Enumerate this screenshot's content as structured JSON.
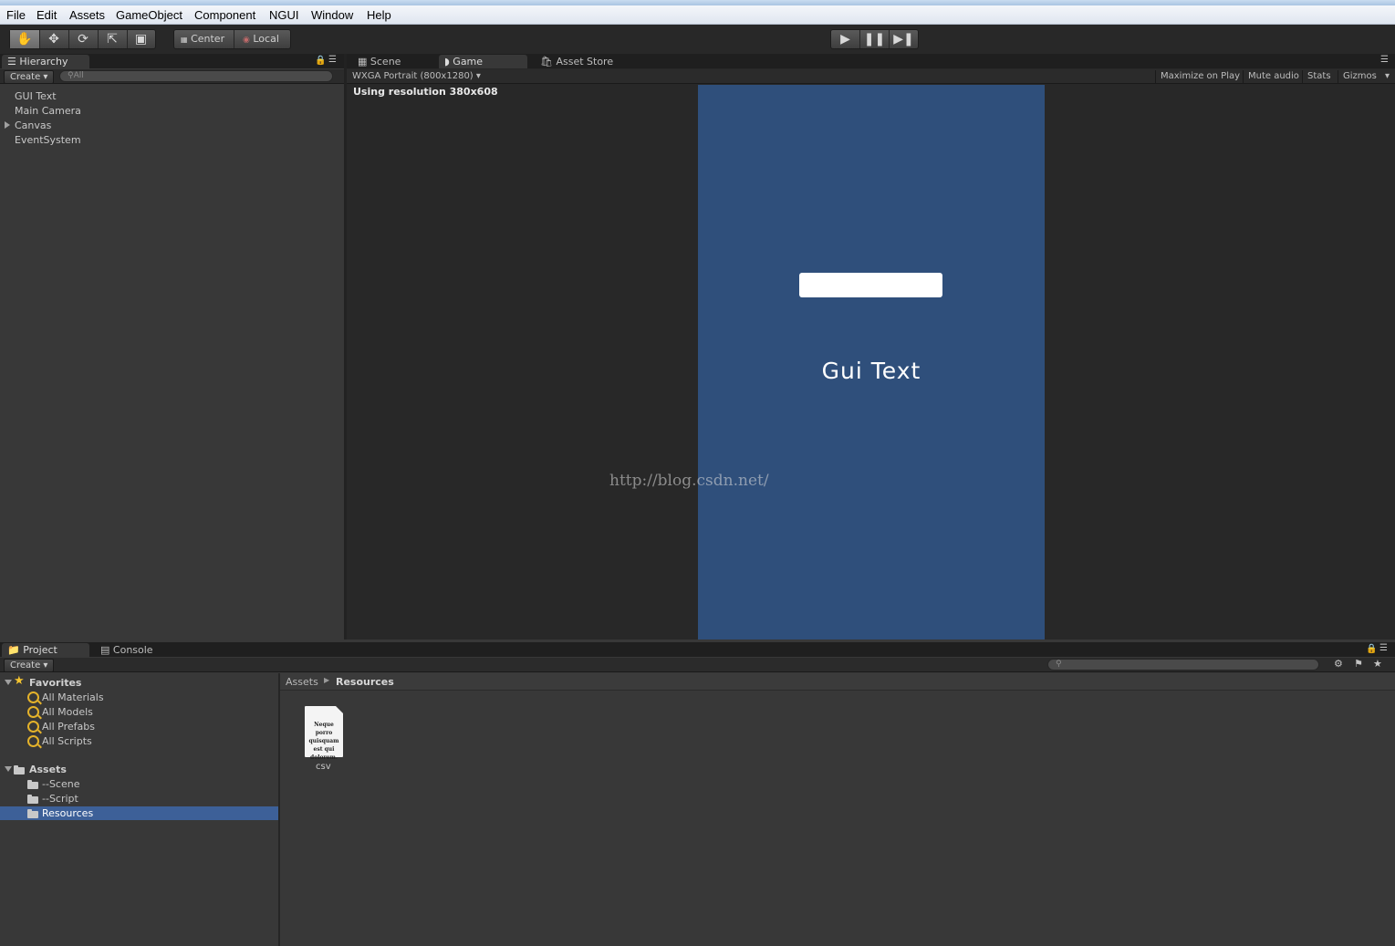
{
  "menubar": {
    "items": [
      "File",
      "Edit",
      "Assets",
      "GameObject",
      "Component",
      "NGUI",
      "Window",
      "Help"
    ]
  },
  "toolbar": {
    "tools": [
      "hand-icon",
      "move-icon",
      "rotate-icon",
      "scale-icon",
      "rect-icon"
    ],
    "pivot_center": "Center",
    "pivot_local": "Local",
    "play_icons": [
      "play-icon",
      "pause-icon",
      "step-icon"
    ]
  },
  "hierarchy": {
    "tab": "Hierarchy",
    "create": "Create",
    "search_placeholder": "All",
    "items": [
      "GUI Text",
      "Main Camera",
      "Canvas",
      "EventSystem"
    ]
  },
  "center_tabs": {
    "scene": "Scene",
    "game": "Game",
    "asset_store": "Asset Store"
  },
  "game": {
    "resolution_dropdown": "WXGA Portrait (800x1280)",
    "toggles": [
      "Maximize on Play",
      "Mute audio",
      "Stats",
      "Gizmos"
    ],
    "resolution_text": "Using resolution 380x608",
    "gui_text": "Gui Text",
    "watermark": "http://blog.csdn.net/"
  },
  "project": {
    "tab": "Project",
    "console_tab": "Console",
    "create": "Create",
    "favorites_header": "Favorites",
    "favorites": [
      "All Materials",
      "All Models",
      "All Prefabs",
      "All Scripts"
    ],
    "assets_header": "Assets",
    "folders": [
      "--Scene",
      "--Script",
      "Resources"
    ],
    "breadcrumb_root": "Assets",
    "breadcrumb_current": "Resources",
    "file_name": "csv",
    "file_thumb_text": "Neque porro quisquam est qui dolorem."
  },
  "colors": {
    "camera_bg": "#2f4f7b",
    "selection": "#3d6098"
  }
}
